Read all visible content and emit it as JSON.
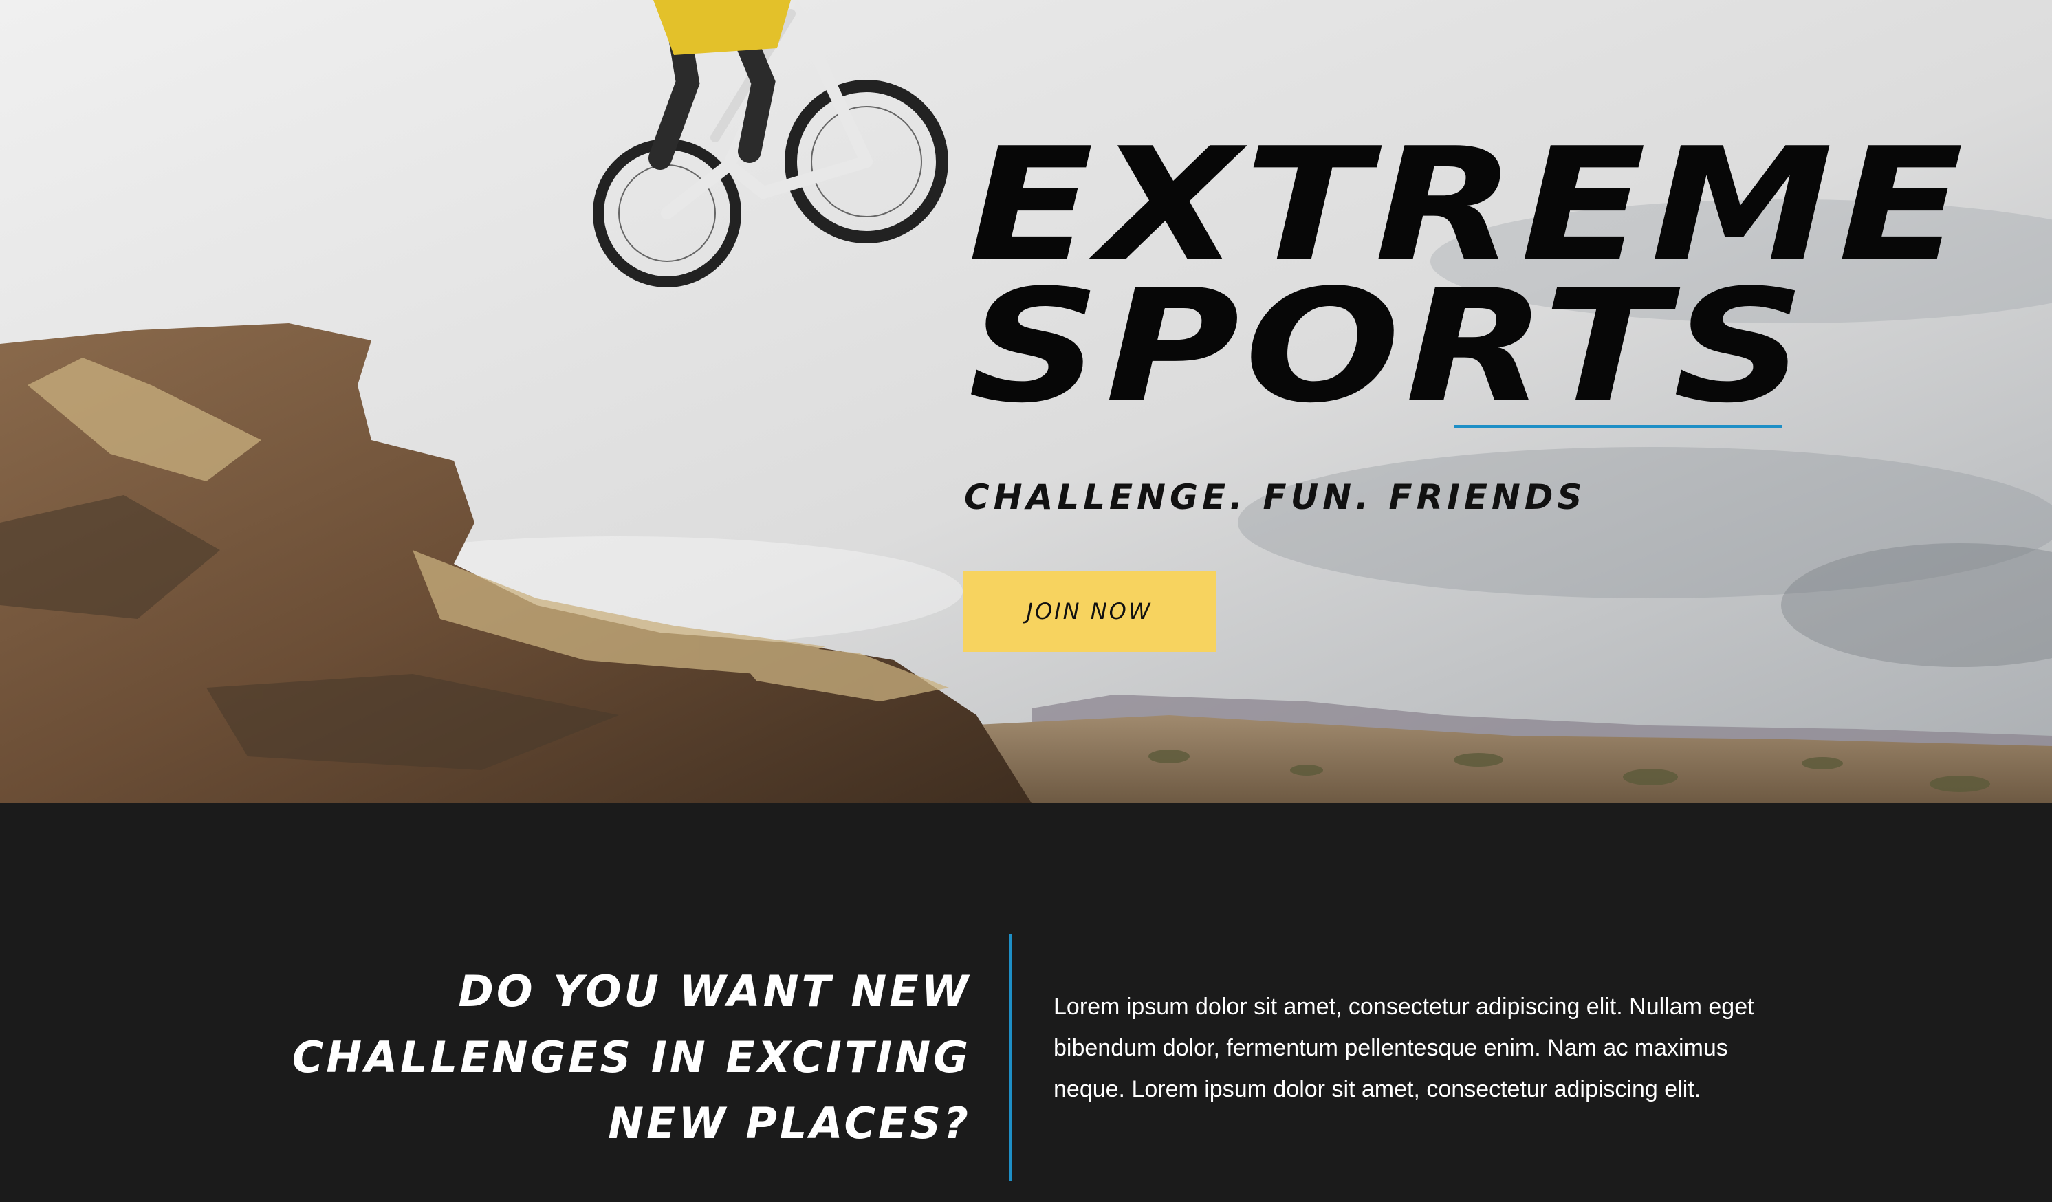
{
  "hero": {
    "title_line1": "EXTREME",
    "title_line2": "SPORTS",
    "tagline": "CHALLENGE. FUN. FRIENDS",
    "cta_label": "JOIN NOW"
  },
  "intro": {
    "heading": "DO YOU WANT NEW CHALLENGES IN EXCITING NEW PLACES?",
    "body": "Lorem ipsum dolor sit amet, consectetur adipiscing elit. Nullam eget bibendum dolor, fermentum pellentesque enim. Nam ac maximus neque. Lorem ipsum dolor sit amet, consectetur adipiscing elit."
  },
  "colors": {
    "accent_blue": "#1e8fc6",
    "button_yellow": "#f7d35f",
    "dark_background": "#1b1b1b",
    "title_text": "#070707"
  }
}
